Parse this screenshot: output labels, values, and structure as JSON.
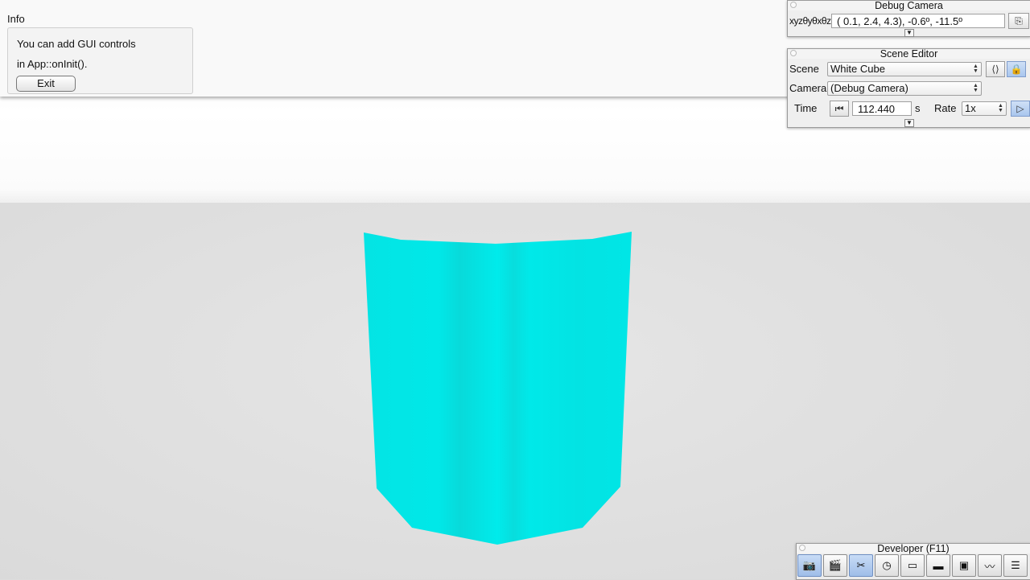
{
  "scene_colors": {
    "object": "#00e8e8",
    "background": "#e0e0e0"
  },
  "info": {
    "title": "Info",
    "line1": "You can add GUI controls",
    "line2": "in App::onInit().",
    "exit_label": "Exit"
  },
  "debug_camera": {
    "title": "Debug Camera",
    "xyz_label": "xyzθyθxθz",
    "coords_value": "(  0.1,   2.4,   4.3),  -0.6º, -11.5º",
    "copy_icon": "copy-icon"
  },
  "scene_editor": {
    "title": "Scene Editor",
    "scene_label": "Scene",
    "scene_value": "White Cube",
    "camera_label": "Camera",
    "camera_value": "(Debug Camera)",
    "time_label": "Time",
    "time_value": "112.440",
    "time_unit": "s",
    "rate_label": "Rate",
    "rate_value": "1x"
  },
  "developer": {
    "title": "Developer (F11)",
    "tools": [
      "camera-icon",
      "clapperboard-icon",
      "tools-icon",
      "clock-icon",
      "new-window-icon",
      "terminal-icon",
      "scene-graph-icon",
      "profiler-icon",
      "document-icon"
    ]
  }
}
